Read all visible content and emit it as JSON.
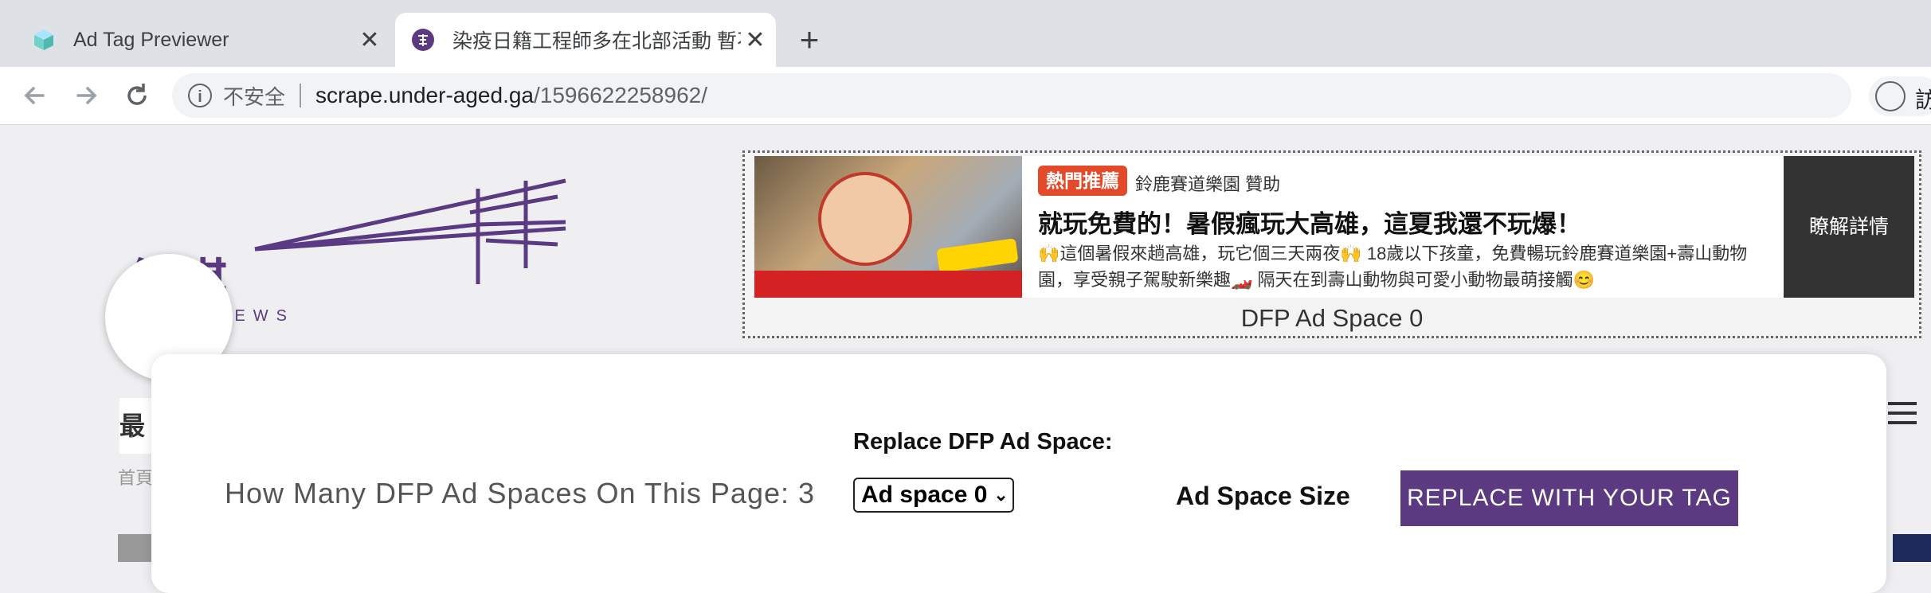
{
  "browser": {
    "tabs": [
      {
        "title": "Ad Tag Previewer",
        "active": false,
        "icon": "ad-tag-previewer-icon"
      },
      {
        "title": "染疫日籍工程師多在北部活動 暫不",
        "active": true,
        "icon": "site-favicon"
      }
    ],
    "new_tab": "+",
    "close_glyph": "✕",
    "omnibox": {
      "security_label": "不安全",
      "url_host": "scrape.under-aged.ga",
      "url_path": "/1596622258962/"
    },
    "profile_label": "訪"
  },
  "site": {
    "logo_cn": "傳媒",
    "logo_en": "NEWS",
    "menu_fragment": "最",
    "breadcrumb": "首頁"
  },
  "ad": {
    "badge": "熱門推薦",
    "sponsor": "鈴鹿賽道樂園 贊助",
    "headline": "就玩免費的！暑假瘋玩大高雄，這夏我還不玩爆！",
    "body": "🙌這個暑假來趟高雄，玩它個三天兩夜🙌 18歲以下孩童，免費暢玩鈴鹿賽道樂園+壽山動物園，享受親子駕駛新樂趣🏎️ 隔天在到壽山動物與可愛小動物最萌接觸😊",
    "cta": "瞭解詳情",
    "caption": "DFP Ad Space 0"
  },
  "panel": {
    "count_label": "How Many DFP Ad Spaces On This Page: 3",
    "replace_label": "Replace DFP Ad Space:",
    "select_value": "Ad space 0",
    "size_label": "Ad Space Size",
    "button_label": "REPLACE WITH YOUR TAG"
  },
  "colors": {
    "brand_purple": "#5b3a82",
    "hot_badge": "#e34a29",
    "cta_bg": "#333333"
  }
}
